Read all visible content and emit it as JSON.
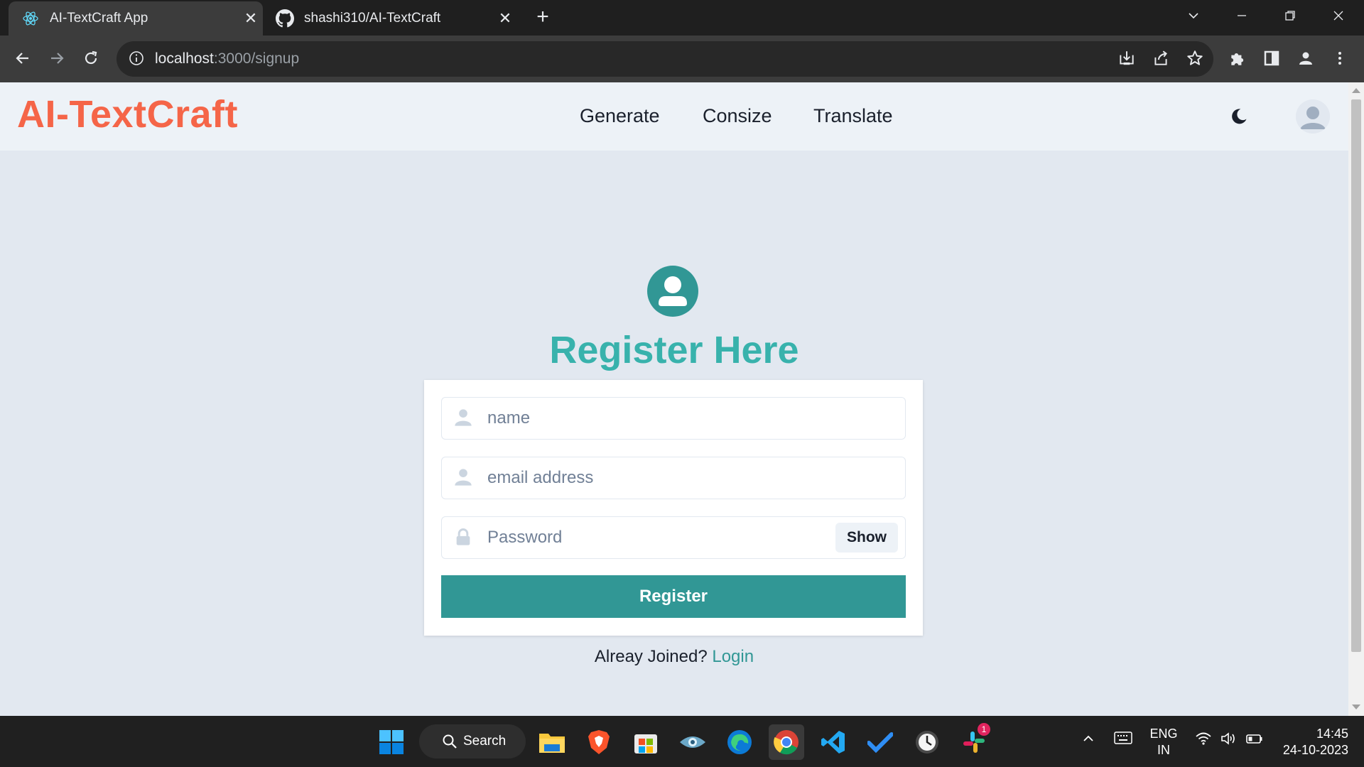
{
  "browser": {
    "tabs": [
      {
        "title": "AI-TextCraft App",
        "active": true,
        "icon": "react-icon"
      },
      {
        "title": "shashi310/AI-TextCraft",
        "active": false,
        "icon": "github-icon"
      }
    ],
    "new_tab": "+",
    "close_glyph": "✕",
    "url_host": "localhost",
    "url_path": ":3000/signup"
  },
  "navbar": {
    "brand": "AI-TextCraft",
    "links": [
      "Generate",
      "Consize",
      "Translate"
    ]
  },
  "form": {
    "title": "Register Here",
    "name_placeholder": "name",
    "email_placeholder": "email address",
    "password_placeholder": "Password",
    "show_label": "Show",
    "submit_label": "Register",
    "already_text": "Alreay Joined?",
    "login_label": "Login"
  },
  "colors": {
    "brand": "#f56548",
    "title": "#38b2ac",
    "button": "#319795",
    "link": "#319795"
  },
  "taskbar": {
    "search_label": "Search",
    "lang_1": "ENG",
    "lang_2": "IN",
    "time": "14:45",
    "date": "24-10-2023",
    "slack_badge": "1"
  }
}
